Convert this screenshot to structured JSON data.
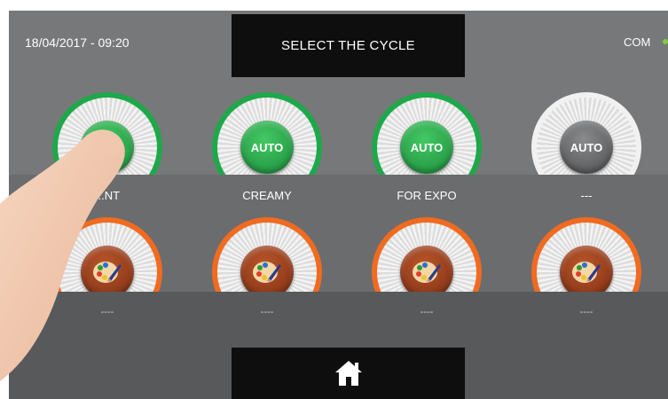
{
  "header": {
    "datetime": "18/04/2017 - 09:20",
    "title": "SELECT THE CYCLE",
    "com_label": "COM",
    "com_status_color": "#7ad13b"
  },
  "cycles_row1": [
    {
      "label": "AUTO",
      "caption": "...NT",
      "color": "green"
    },
    {
      "label": "AUTO",
      "caption": "CREAMY",
      "color": "green"
    },
    {
      "label": "AUTO",
      "caption": "FOR EXPO",
      "color": "green"
    },
    {
      "label": "AUTO",
      "caption": "---",
      "color": "grey"
    }
  ],
  "cycles_row2": [
    {
      "icon": "palette-brush-icon",
      "caption": "----"
    },
    {
      "icon": "palette-brush-icon",
      "caption": "----"
    },
    {
      "icon": "palette-brush-icon",
      "caption": "----"
    },
    {
      "icon": "palette-brush-icon",
      "caption": "----"
    }
  ],
  "footer": {
    "home_icon": "home-icon"
  },
  "colors": {
    "green": "#1ea84a",
    "orange": "#f06b20",
    "grey": "#f1f1f1",
    "panel": "#0e0e0e"
  }
}
